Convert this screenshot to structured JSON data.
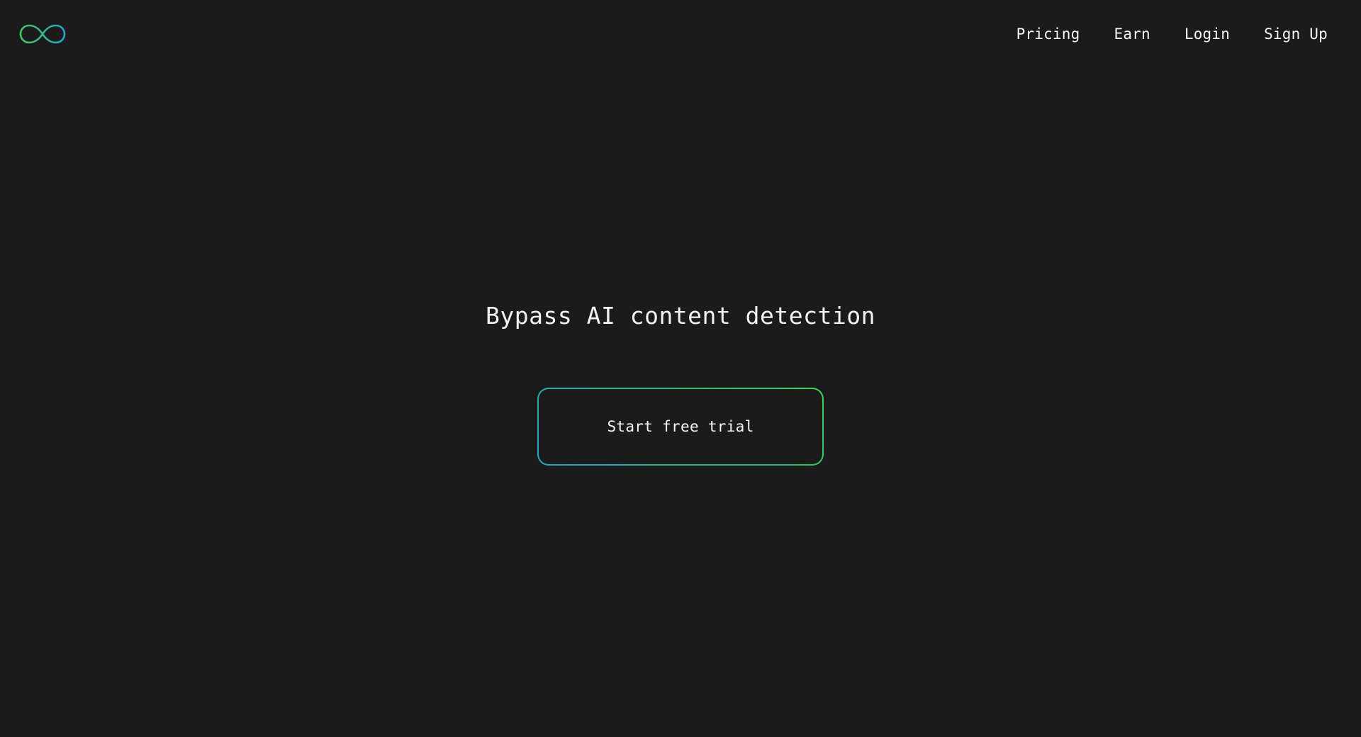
{
  "header": {
    "logo_icon": "infinity-icon",
    "colors": {
      "logo_left": "#3ec85a",
      "logo_right": "#2a9fd0"
    },
    "nav": [
      {
        "label": "Pricing"
      },
      {
        "label": "Earn"
      },
      {
        "label": "Login"
      },
      {
        "label": "Sign Up"
      }
    ]
  },
  "hero": {
    "title": "Bypass AI content detection",
    "cta_label": "Start free trial",
    "cta_border_colors": [
      "#2aa3c9",
      "#3ed35a"
    ]
  },
  "theme": {
    "background": "#1b1b1b",
    "text": "#f2f2f2"
  }
}
